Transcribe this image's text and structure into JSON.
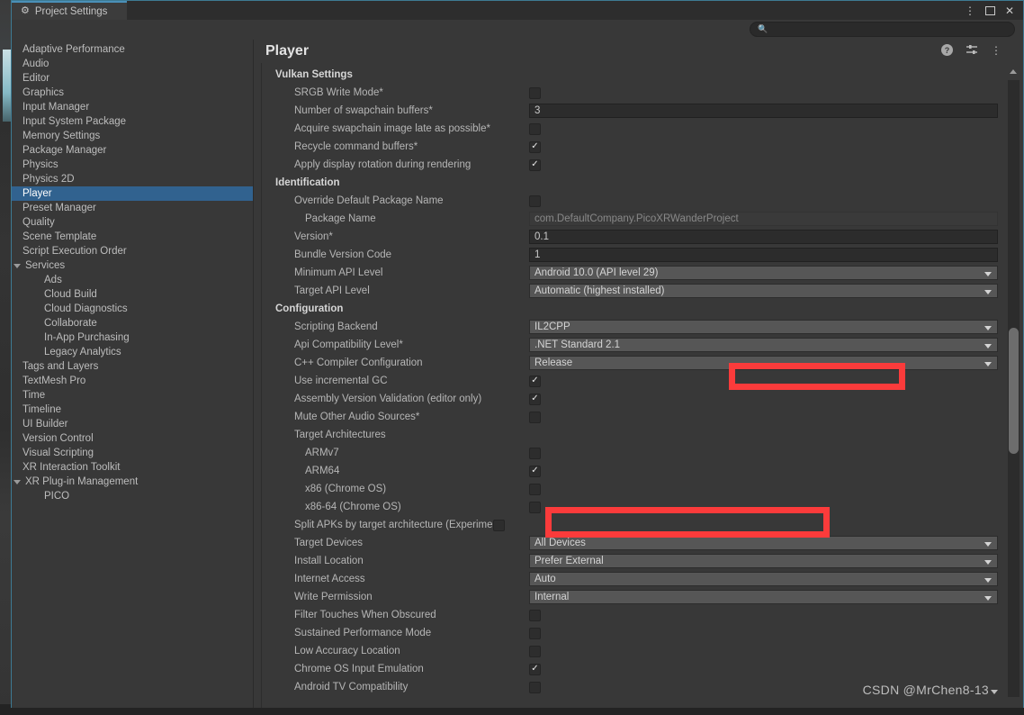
{
  "window": {
    "tab_title": "Project Settings",
    "gear_icon": "gear-icon",
    "controls": {
      "kebab": "⋮",
      "maximize": "",
      "close": "✕"
    }
  },
  "search": {
    "placeholder": "",
    "value": "",
    "icon": "search-icon"
  },
  "sidebar": {
    "items": [
      {
        "label": "Adaptive Performance",
        "level": 0,
        "selected": false,
        "foldout": false
      },
      {
        "label": "Audio",
        "level": 0,
        "selected": false,
        "foldout": false
      },
      {
        "label": "Editor",
        "level": 0,
        "selected": false,
        "foldout": false
      },
      {
        "label": "Graphics",
        "level": 0,
        "selected": false,
        "foldout": false
      },
      {
        "label": "Input Manager",
        "level": 0,
        "selected": false,
        "foldout": false
      },
      {
        "label": "Input System Package",
        "level": 0,
        "selected": false,
        "foldout": false
      },
      {
        "label": "Memory Settings",
        "level": 0,
        "selected": false,
        "foldout": false
      },
      {
        "label": "Package Manager",
        "level": 0,
        "selected": false,
        "foldout": false
      },
      {
        "label": "Physics",
        "level": 0,
        "selected": false,
        "foldout": false
      },
      {
        "label": "Physics 2D",
        "level": 0,
        "selected": false,
        "foldout": false
      },
      {
        "label": "Player",
        "level": 0,
        "selected": true,
        "foldout": false
      },
      {
        "label": "Preset Manager",
        "level": 0,
        "selected": false,
        "foldout": false
      },
      {
        "label": "Quality",
        "level": 0,
        "selected": false,
        "foldout": false
      },
      {
        "label": "Scene Template",
        "level": 0,
        "selected": false,
        "foldout": false
      },
      {
        "label": "Script Execution Order",
        "level": 0,
        "selected": false,
        "foldout": false
      },
      {
        "label": "Services",
        "level": 0,
        "selected": false,
        "foldout": true
      },
      {
        "label": "Ads",
        "level": 1,
        "selected": false,
        "foldout": false
      },
      {
        "label": "Cloud Build",
        "level": 1,
        "selected": false,
        "foldout": false
      },
      {
        "label": "Cloud Diagnostics",
        "level": 1,
        "selected": false,
        "foldout": false
      },
      {
        "label": "Collaborate",
        "level": 1,
        "selected": false,
        "foldout": false
      },
      {
        "label": "In-App Purchasing",
        "level": 1,
        "selected": false,
        "foldout": false
      },
      {
        "label": "Legacy Analytics",
        "level": 1,
        "selected": false,
        "foldout": false
      },
      {
        "label": "Tags and Layers",
        "level": 0,
        "selected": false,
        "foldout": false
      },
      {
        "label": "TextMesh Pro",
        "level": 0,
        "selected": false,
        "foldout": false
      },
      {
        "label": "Time",
        "level": 0,
        "selected": false,
        "foldout": false
      },
      {
        "label": "Timeline",
        "level": 0,
        "selected": false,
        "foldout": false
      },
      {
        "label": "UI Builder",
        "level": 0,
        "selected": false,
        "foldout": false
      },
      {
        "label": "Version Control",
        "level": 0,
        "selected": false,
        "foldout": false
      },
      {
        "label": "Visual Scripting",
        "level": 0,
        "selected": false,
        "foldout": false
      },
      {
        "label": "XR Interaction Toolkit",
        "level": 0,
        "selected": false,
        "foldout": false
      },
      {
        "label": "XR Plug-in Management",
        "level": 0,
        "selected": false,
        "foldout": true
      },
      {
        "label": "PICO",
        "level": 1,
        "selected": false,
        "foldout": false
      }
    ]
  },
  "panel": {
    "title": "Player",
    "help_icon": "?",
    "preset_icon": "preset-icon",
    "menu_icon": "⋮"
  },
  "sections": [
    {
      "title": "Vulkan Settings",
      "rows": [
        {
          "label": "SRGB Write Mode*",
          "type": "checkbox",
          "checked": false,
          "indent": 1
        },
        {
          "label": "Number of swapchain buffers*",
          "type": "field",
          "value": "3",
          "indent": 1
        },
        {
          "label": "Acquire swapchain image late as possible*",
          "type": "checkbox",
          "checked": false,
          "indent": 1
        },
        {
          "label": "Recycle command buffers*",
          "type": "checkbox",
          "checked": true,
          "indent": 1
        },
        {
          "label": "Apply display rotation during rendering",
          "type": "checkbox",
          "checked": true,
          "indent": 1
        }
      ]
    },
    {
      "title": "Identification",
      "rows": [
        {
          "label": "Override Default Package Name",
          "type": "checkbox",
          "checked": false,
          "indent": 1
        },
        {
          "label": "Package Name",
          "type": "field-readonly",
          "value": "com.DefaultCompany.PicoXRWanderProject",
          "indent": 2,
          "dim": true
        },
        {
          "label": "Version*",
          "type": "field",
          "value": "0.1",
          "indent": 1
        },
        {
          "label": "Bundle Version Code",
          "type": "field",
          "value": "1",
          "indent": 1
        },
        {
          "label": "Minimum API Level",
          "type": "dropdown",
          "value": "Android 10.0 (API level 29)",
          "indent": 1
        },
        {
          "label": "Target API Level",
          "type": "dropdown",
          "value": "Automatic (highest installed)",
          "indent": 1
        }
      ]
    },
    {
      "title": "Configuration",
      "rows": [
        {
          "label": "Scripting Backend",
          "type": "dropdown",
          "value": "IL2CPP",
          "indent": 1,
          "highlighted": true
        },
        {
          "label": "Api Compatibility Level*",
          "type": "dropdown",
          "value": ".NET Standard 2.1",
          "indent": 1
        },
        {
          "label": "C++ Compiler Configuration",
          "type": "dropdown",
          "value": "Release",
          "indent": 1
        },
        {
          "label": "Use incremental GC",
          "type": "checkbox",
          "checked": true,
          "indent": 1
        },
        {
          "label": "Assembly Version Validation (editor only)",
          "type": "checkbox",
          "checked": true,
          "indent": 1
        },
        {
          "label": "Mute Other Audio Sources*",
          "type": "checkbox",
          "checked": false,
          "indent": 1
        },
        {
          "label": "Target Architectures",
          "type": "group",
          "indent": 1
        },
        {
          "label": "ARMv7",
          "type": "checkbox",
          "checked": false,
          "indent": 2
        },
        {
          "label": "ARM64",
          "type": "checkbox",
          "checked": true,
          "indent": 2,
          "highlighted": true
        },
        {
          "label": "x86 (Chrome OS)",
          "type": "checkbox",
          "checked": false,
          "indent": 2
        },
        {
          "label": "x86-64 (Chrome OS)",
          "type": "checkbox",
          "checked": false,
          "indent": 2
        },
        {
          "label": "Split APKs by target architecture (Experimental)",
          "type": "checkbox",
          "checked": false,
          "indent": 1,
          "clip": true
        },
        {
          "label": "Target Devices",
          "type": "dropdown",
          "value": "All Devices",
          "indent": 1
        },
        {
          "label": "Install Location",
          "type": "dropdown",
          "value": "Prefer External",
          "indent": 1
        },
        {
          "label": "Internet Access",
          "type": "dropdown",
          "value": "Auto",
          "indent": 1
        },
        {
          "label": "Write Permission",
          "type": "dropdown",
          "value": "Internal",
          "indent": 1
        },
        {
          "label": "Filter Touches When Obscured",
          "type": "checkbox",
          "checked": false,
          "indent": 1
        },
        {
          "label": "Sustained Performance Mode",
          "type": "checkbox",
          "checked": false,
          "indent": 1
        },
        {
          "label": "Low Accuracy Location",
          "type": "checkbox",
          "checked": false,
          "indent": 1
        },
        {
          "label": "Chrome OS Input Emulation",
          "type": "checkbox",
          "checked": true,
          "indent": 1
        },
        {
          "label": "Android TV Compatibility",
          "type": "checkbox",
          "checked": false,
          "indent": 1
        }
      ]
    }
  ],
  "watermark": {
    "text": "CSDN @MrChen8-13"
  },
  "colors": {
    "accent_selected": "#31628f",
    "annotation_red": "#fb3b3b",
    "panel_bg": "#383838",
    "field_bg": "#2c2c2c",
    "dropdown_bg": "#565656"
  }
}
